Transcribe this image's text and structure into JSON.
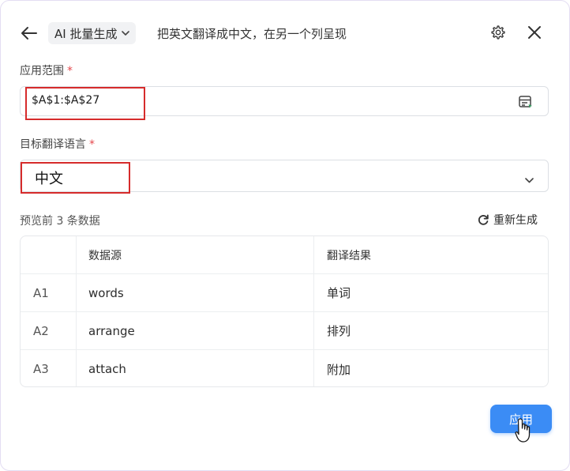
{
  "header": {
    "mode_label": "AI 批量生成",
    "prompt": "把英文翻译成中文，在另一个列呈现"
  },
  "range_field": {
    "label": "应用范围",
    "required_mark": "*",
    "value": "$A$1:$A$27"
  },
  "language_field": {
    "label": "目标翻译语言",
    "required_mark": "*",
    "value": "中文"
  },
  "preview": {
    "label": "预览前 3 条数据",
    "regenerate_label": "重新生成",
    "columns": [
      "",
      "数据源",
      "翻译结果"
    ],
    "rows": [
      {
        "cell": "A1",
        "source": "words",
        "result": "单词"
      },
      {
        "cell": "A2",
        "source": "arrange",
        "result": "排列"
      },
      {
        "cell": "A3",
        "source": "attach",
        "result": "附加"
      }
    ]
  },
  "actions": {
    "apply_label": "应用"
  },
  "icons": {
    "back": "arrow-left-icon",
    "mode_dropdown": "chevron-down-icon",
    "settings": "gear-icon",
    "close": "close-icon",
    "range_picker": "table-select-icon",
    "language_dropdown": "chevron-down-icon",
    "regenerate": "refresh-icon"
  },
  "colors": {
    "primary": "#3b8cf5",
    "highlight_box": "#d62b2b",
    "required": "#e5484d"
  }
}
